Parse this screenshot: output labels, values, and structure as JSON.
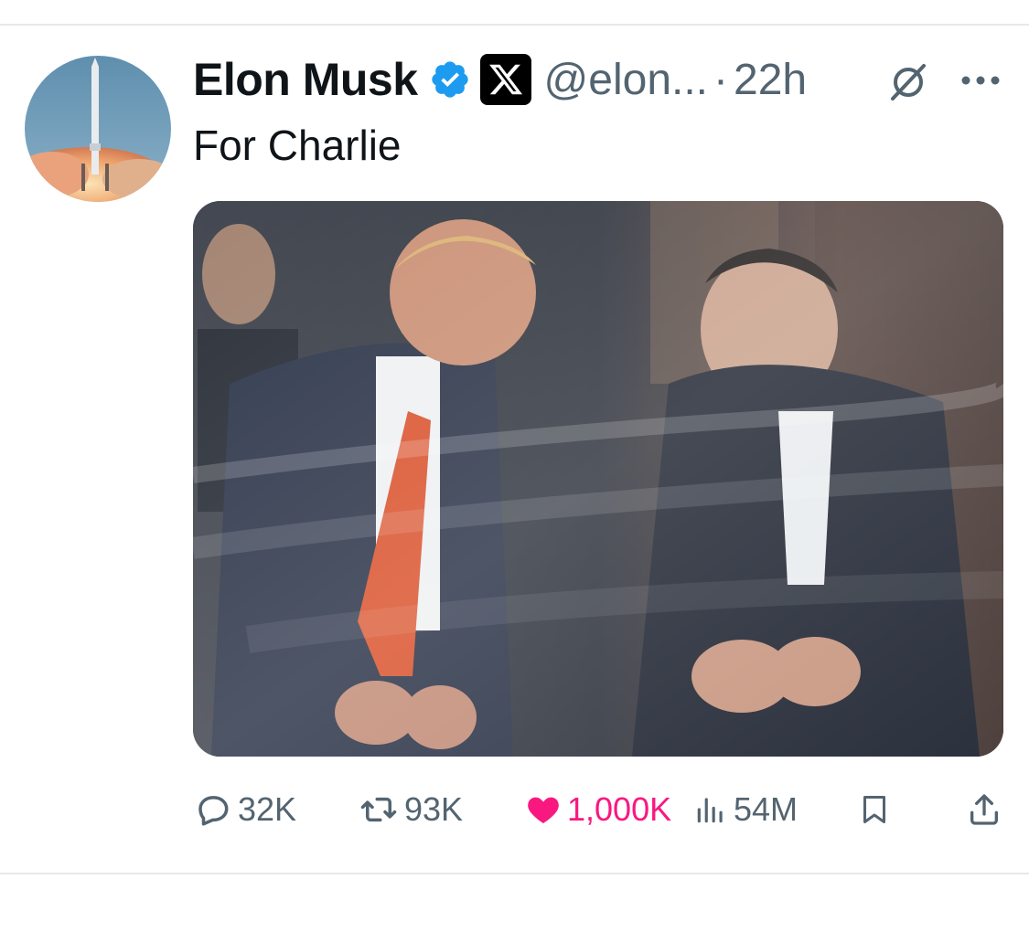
{
  "post": {
    "author_name": "Elon Musk",
    "handle": "@elon...",
    "separator": "·",
    "time": "22h",
    "text": "For Charlie",
    "avatar_icon": "rocket-launch-avatar",
    "media_description_icon": "photo"
  },
  "actions": {
    "replies": "32K",
    "reposts": "93K",
    "likes": "1,000K",
    "views": "54M"
  },
  "colors": {
    "verified_blue": "#1d9bf0",
    "like_pink": "#f91880",
    "muted_text": "#536471"
  }
}
